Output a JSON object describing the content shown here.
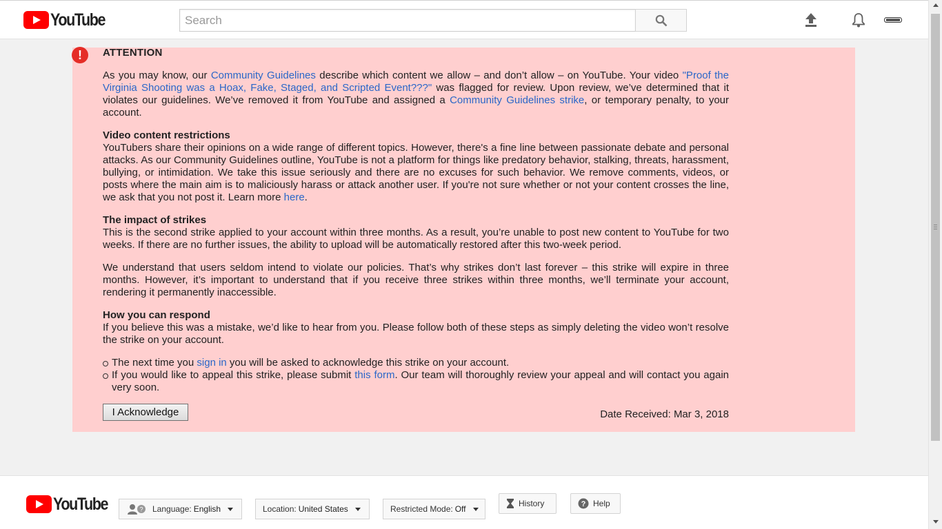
{
  "header": {
    "logo_text": "YouTube",
    "search_placeholder": "Search",
    "icons": [
      "search-icon",
      "upload-icon",
      "bell-icon",
      "account-icon"
    ]
  },
  "notice": {
    "title": "ATTENTION",
    "intro": {
      "t1": "As you may know, our ",
      "l1": "Community Guidelines",
      "t2": " describe which content we allow – and don’t allow – on YouTube. Your video ",
      "l2": "\"Proof the Virginia Shooting was a Hoax, Fake, Staged, and Scripted Event???\"",
      "t3": " was flagged for review. Upon review, we’ve determined that it violates our guidelines. We’ve removed it from YouTube and assigned a ",
      "l3": "Community Guidelines strike",
      "t4": ", or temporary penalty, to your account."
    },
    "restrictions": {
      "heading": "Video content restrictions",
      "text": "YouTubers share their opinions on a wide range of different topics. However, there's a fine line between passionate debate and personal attacks. As our Community Guidelines outline, YouTube is not a platform for things like predatory behavior, stalking, threats, harassment, bullying, or intimidation. We take this issue seriously and there are no excuses for such behavior. We remove comments, videos, or posts where the main aim is to maliciously harass or attack another user. If you're not sure whether or not your content crosses the line, we ask that you not post it. Learn more ",
      "link": "here",
      "end": "."
    },
    "impact": {
      "heading": "The impact of strikes",
      "text": "This is the second strike applied to your account within three months. As a result, you’re unable to post new content to YouTube for two weeks. If there are no further issues, the ability to upload will be automatically restored after this two-week period.",
      "text2": "We understand that users seldom intend to violate our policies. That’s why strikes don’t last forever – this strike will expire in three months. However, it’s important to understand that if you receive three strikes within three months, we’ll terminate your account, rendering it permanently inaccessible."
    },
    "respond": {
      "heading": "How you can respond",
      "text": "If you believe this was a mistake, we’d like to hear from you. Please follow both of these steps as simply deleting the video won’t resolve the strike on your account.",
      "b1_pre": "The next time you ",
      "b1_link": "sign in",
      "b1_post": " you will be asked to acknowledge this strike on your account.",
      "b2_pre": "If you would like to appeal this strike, please submit ",
      "b2_link": "this form",
      "b2_post": ". Our team will thoroughly review your appeal and will contact you again very soon."
    },
    "ack_button": "I Acknowledge",
    "date_received": "Date Received: Mar 3, 2018"
  },
  "footer": {
    "logo_text": "YouTube",
    "language_label": "Language:",
    "language_value": "English",
    "location_label": "Location:",
    "location_value": "United States",
    "restricted_label": "Restricted Mode:",
    "restricted_value": "Off",
    "history_label": "History",
    "help_label": "Help"
  },
  "colors": {
    "notice_bg": "#ffcfcf",
    "link": "#2a67c8",
    "brand_red": "#ff0000",
    "alert_red": "#e52d27"
  }
}
